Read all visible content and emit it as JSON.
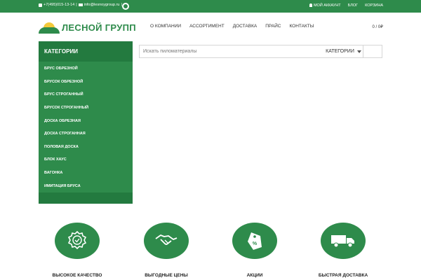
{
  "colors": {
    "brand_green": "#2e8b4b",
    "dark_green": "#237a3f",
    "sun_yellow": "#f3c93b"
  },
  "topbar": {
    "phone": "+7(495)015-13-14",
    "email": "info@lesnoygroup.ru",
    "separator": "|",
    "account": "МОЙ АККАУНТ",
    "blog": "БЛОГ",
    "cart": "КОРЗИНА"
  },
  "header": {
    "logo_text": "ЛЕСНОЙ ГРУПП",
    "nav": [
      "О КОМПАНИИ",
      "АССОРТИМЕНТ",
      "ДОСТАВКА",
      "ПРАЙС",
      "КОНТАКТЫ"
    ],
    "cart_summary": "0 / 0₽"
  },
  "sidebar": {
    "title": "КАТЕГОРИИ",
    "items": [
      "БРУС ОБРЕЗНОЙ",
      "БРУСОК ОБРЕЗНОЙ",
      "БРУС СТРОГАННЫЙ",
      "БРУСОК СТРОГАННЫЙ",
      "ДОСКА ОБРЕЗНАЯ",
      "ДОСКА СТРОГАННАЯ",
      "ПОЛОВАЯ ДОСКА",
      "БЛОК ХАУС",
      "ВАГОНКА",
      "ИМИТАЦИЯ БРУСА"
    ]
  },
  "search": {
    "placeholder": "Искать пиломатериалы",
    "category_label": "КАТЕГОРИИ"
  },
  "features": [
    {
      "label": "ВЫСОКОЕ КАЧЕСТВО",
      "icon": "quality-badge-icon"
    },
    {
      "label": "ВЫГОДНЫЕ ЦЕНЫ",
      "icon": "handshake-icon"
    },
    {
      "label": "АКЦИИ",
      "icon": "discount-tag-icon"
    },
    {
      "label": "БЫСТРАЯ ДОСТАВКА",
      "icon": "delivery-truck-icon"
    }
  ]
}
